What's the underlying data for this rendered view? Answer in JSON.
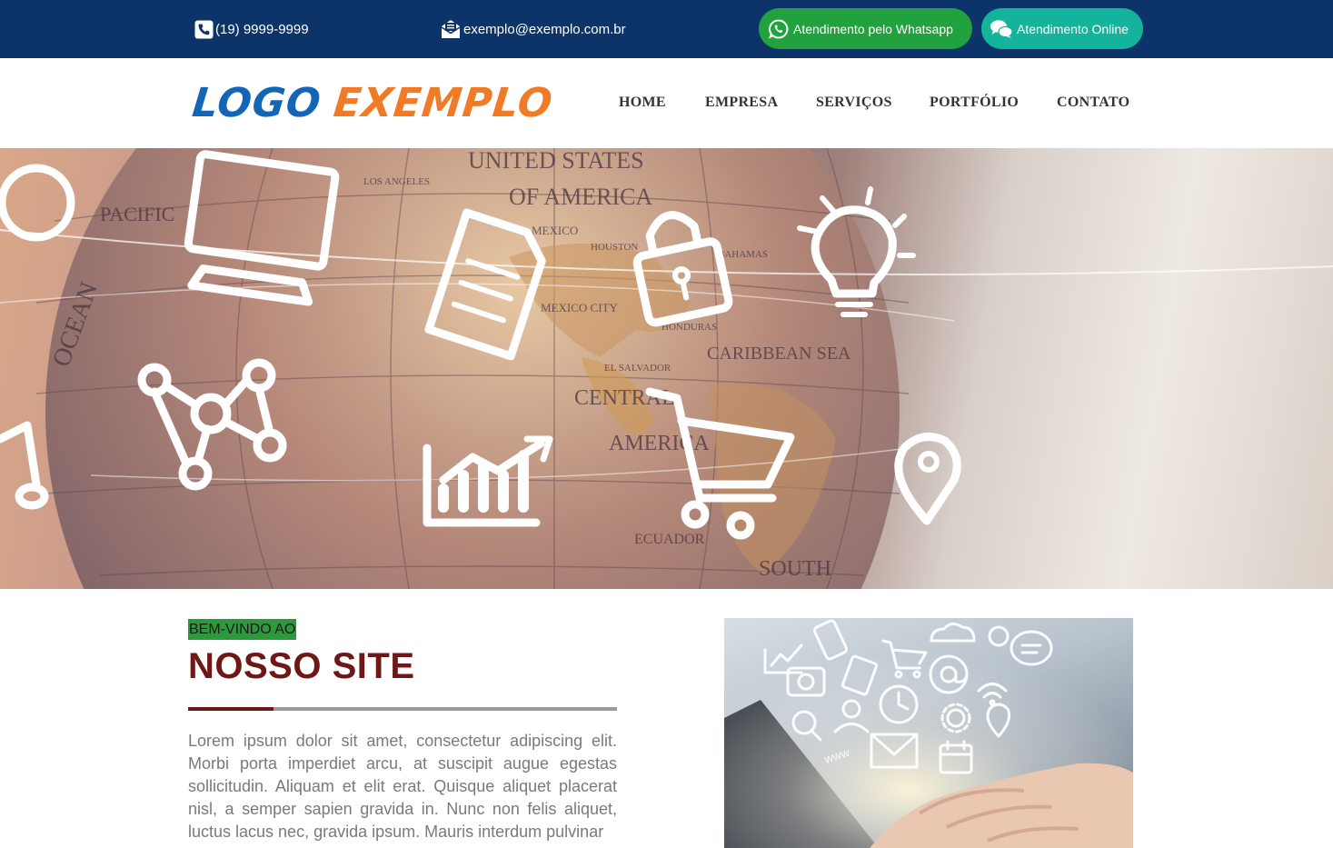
{
  "topbar": {
    "phone": "(19) 9999-9999",
    "email": "exemplo@exemplo.com.br",
    "whatsapp_label": "Atendimento pelo Whatsapp",
    "online_label": "Atendimento Online",
    "colors": {
      "bar": "#0c3468",
      "whatsapp": "#21a23e",
      "online": "#14b39b"
    }
  },
  "header": {
    "logo_part1": "LOGO",
    "logo_part2": "EXEMPLO",
    "logo_colors": {
      "part1": "#1366b7",
      "part2": "#f07a26"
    },
    "nav": [
      "HOME",
      "EMPRESA",
      "SERVIÇOS",
      "PORTFÓLIO",
      "CONTATO"
    ]
  },
  "hero": {
    "map_labels": [
      "UNITED STATES",
      "OF AMERICA",
      "OCEAN",
      "PACIFIC",
      "LOS ANGELES",
      "HOUSTON",
      "MEXICO",
      "MEXICO CITY",
      "EL SALVADOR",
      "HONDURAS",
      "CARIBBEAN SEA",
      "CENTRAL",
      "AMERICA",
      "ECUADOR",
      "SOUTH",
      "BAHAMAS"
    ],
    "icons": [
      "monitor-icon",
      "document-icon",
      "padlock-icon",
      "lightbulb-icon",
      "network-icon",
      "bar-chart-icon",
      "shopping-cart-icon",
      "music-note-icon",
      "map-pin-icon"
    ]
  },
  "welcome": {
    "kicker": "BEM-VINDO AO",
    "title": "NOSSO SITE",
    "body": "Lorem ipsum dolor sit amet, consectetur adipiscing elit. Morbi porta imperdiet arcu, at suscipit augue egestas sollicitudin. Aliquam et elit erat. Quisque aliquet placerat nisl, a semper sapien gravida in. Nunc non felis aliquet, luctus lacus nec, gravida ipsum. Mauris interdum pulvinar",
    "accent_color": "#6d1717",
    "kicker_bg": "#2c9a3a"
  },
  "feature_image": {
    "caption_text": "www",
    "icons": [
      "chart-icon",
      "phone-icon",
      "cloud-icon",
      "money-icon",
      "chat-icon",
      "camera-icon",
      "cart-icon",
      "at-sign-icon",
      "wifi-icon",
      "clock-icon",
      "user-icon",
      "pin-icon",
      "search-icon",
      "envelope-icon",
      "calendar-icon",
      "gear-icon"
    ]
  }
}
